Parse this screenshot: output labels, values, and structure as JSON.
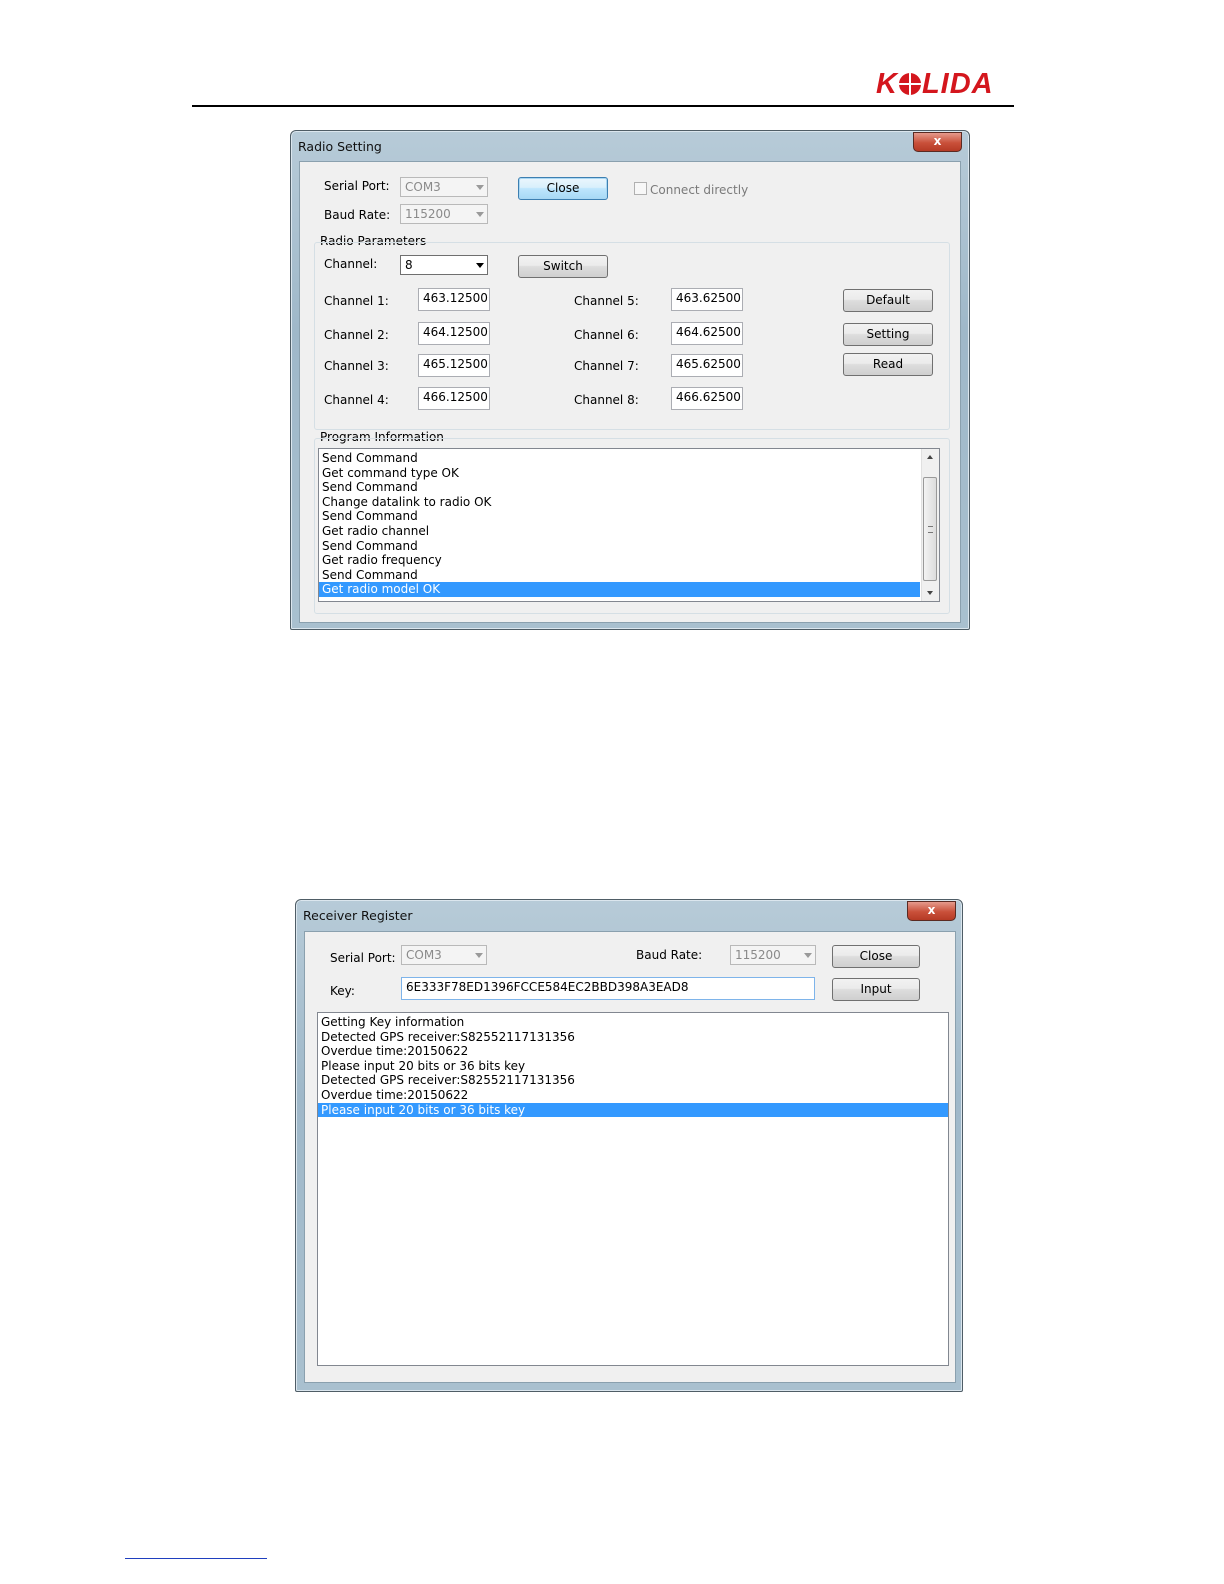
{
  "header": {
    "logo_text_left": "K",
    "logo_text_right": "LIDA"
  },
  "radio_setting": {
    "title": "Radio Setting",
    "close_x": "x",
    "serial_port_label": "Serial Port:",
    "serial_port_value": "COM3",
    "baud_rate_label": "Baud Rate:",
    "baud_rate_value": "115200",
    "close_button": "Close",
    "connect_directly_label": "Connect directly",
    "radio_parameters_label": "Radio Parameters",
    "channel_label": "Channel:",
    "channel_value": "8",
    "switch_button": "Switch",
    "channels": [
      {
        "label": "Channel 1:",
        "value": "463.12500"
      },
      {
        "label": "Channel 2:",
        "value": "464.12500"
      },
      {
        "label": "Channel 3:",
        "value": "465.12500"
      },
      {
        "label": "Channel 4:",
        "value": "466.12500"
      },
      {
        "label": "Channel 5:",
        "value": "463.62500"
      },
      {
        "label": "Channel 6:",
        "value": "464.62500"
      },
      {
        "label": "Channel 7:",
        "value": "465.62500"
      },
      {
        "label": "Channel 8:",
        "value": "466.62500"
      }
    ],
    "default_button": "Default",
    "setting_button": "Setting",
    "read_button": "Read",
    "program_information_label": "Program Information",
    "log": [
      "Send Command",
      "Get command type OK",
      "Send Command",
      "Change datalink to radio OK",
      "Send Command",
      "Get radio channel",
      "Send Command",
      "Get radio frequency",
      "Send Command",
      "Get radio model OK"
    ]
  },
  "receiver_register": {
    "title": "Receiver Register",
    "close_x": "x",
    "serial_port_label": "Serial Port:",
    "serial_port_value": "COM3",
    "baud_rate_label": "Baud Rate:",
    "baud_rate_value": "115200",
    "close_button": "Close",
    "key_label": "Key:",
    "key_value": "6E333F78ED1396FCCE584EC2BBD398A3EAD8",
    "input_button": "Input",
    "log": [
      "Getting Key information",
      "Detected GPS receiver:S82552117131356",
      "Overdue time:20150622",
      "Please input 20 bits or 36 bits key",
      "Detected GPS receiver:S82552117131356",
      "Overdue time:20150622",
      "Please input 20 bits or 36 bits key"
    ]
  }
}
